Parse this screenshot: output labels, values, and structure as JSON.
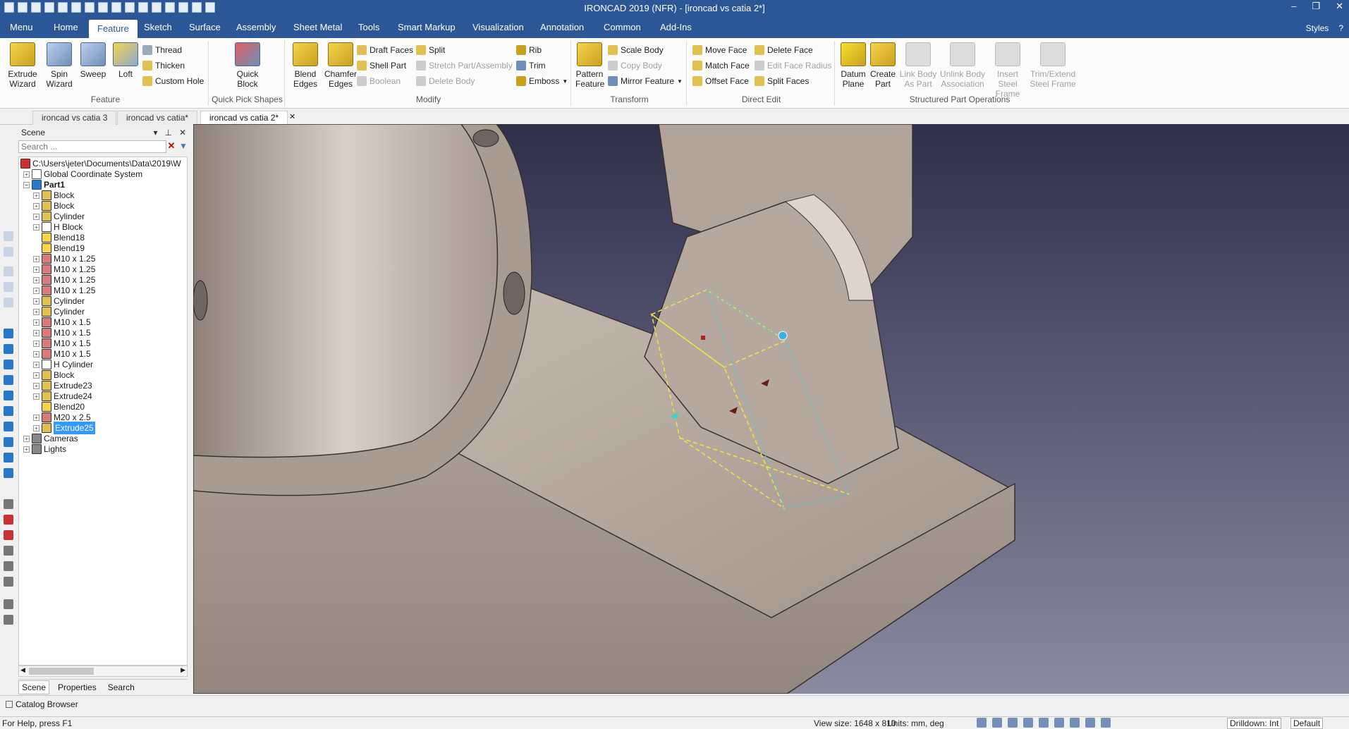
{
  "window": {
    "title": "IRONCAD 2019 (NFR) - [ironcad vs catia 2*]",
    "minimize": "–",
    "restore": "❐",
    "close": "✕"
  },
  "ribbon_tabs": [
    "Menu",
    "Home",
    "Feature",
    "Sketch",
    "Surface",
    "Assembly",
    "Sheet Metal",
    "Tools",
    "Smart Markup",
    "Visualization",
    "Annotation",
    "Common",
    "Add-Ins"
  ],
  "ribbon_right": {
    "styles": "Styles",
    "help": "?"
  },
  "groups": {
    "feature": {
      "label": "Feature",
      "big": [
        "Extrude Wizard",
        "Spin Wizard",
        "Sweep",
        "Loft"
      ],
      "small": [
        "Thread",
        "Thicken",
        "Custom Hole"
      ]
    },
    "quick": {
      "label": "Quick Pick Shapes",
      "big": [
        "Quick Block"
      ]
    },
    "modify": {
      "label": "Modify",
      "big": [
        "Blend Edges",
        "Chamfer Edges"
      ],
      "small": [
        "Draft Faces",
        "Shell Part",
        "Boolean",
        "Split",
        "Stretch Part/Assembly",
        "Delete Body",
        "Rib",
        "Trim",
        "Emboss"
      ]
    },
    "transform": {
      "label": "Transform",
      "big": [
        "Pattern Feature"
      ],
      "small": [
        "Scale Body",
        "Copy Body",
        "Mirror Feature"
      ]
    },
    "direct": {
      "label": "Direct Edit",
      "small": [
        "Move Face",
        "Match Face",
        "Offset Face",
        "Delete Face",
        "Edit Face Radius",
        "Split Faces"
      ]
    },
    "structured": {
      "label": "Structured Part Operations",
      "big": [
        "Datum Plane",
        "Create Part",
        "Link Body As Part",
        "Unlink Body Association",
        "Insert Steel Frame",
        "Trim/Extend Steel Frame"
      ]
    }
  },
  "doc_tabs": [
    "ironcad vs catia 3",
    "ironcad vs catia*",
    "ironcad vs catia 2*"
  ],
  "scene": {
    "title": "Scene",
    "search_placeholder": "Search ...",
    "path": "C:\\Users\\jeter\\Documents\\Data\\2019\\W",
    "gcs": "Global Coordinate System",
    "part": "Part1",
    "items": [
      "Block",
      "Block",
      "Cylinder",
      "H Block",
      "Blend18",
      "Blend19",
      "M10 x 1.25",
      "M10 x 1.25",
      "M10 x 1.25",
      "M10 x 1.25",
      "Cylinder",
      "Cylinder",
      "M10 x 1.5",
      "M10 x 1.5",
      "M10 x 1.5",
      "M10 x 1.5",
      "H Cylinder",
      "Block",
      "Extrude23",
      "Extrude24",
      "Blend20",
      "M20 x 2.5",
      "Extrude25"
    ],
    "cameras": "Cameras",
    "lights": "Lights",
    "bottom_tabs": [
      "Scene",
      "Properties",
      "Search"
    ]
  },
  "catalog": "Catalog Browser",
  "status": {
    "help": "For Help, press F1",
    "view_size": "View size: 1648 x 810",
    "units": "Units: mm, deg",
    "drilldown": "Drilldown: Int",
    "default": "Default"
  },
  "colors": {
    "accent": "#2b5797",
    "selection": "#3399ff",
    "part": "#b7aaa0"
  }
}
